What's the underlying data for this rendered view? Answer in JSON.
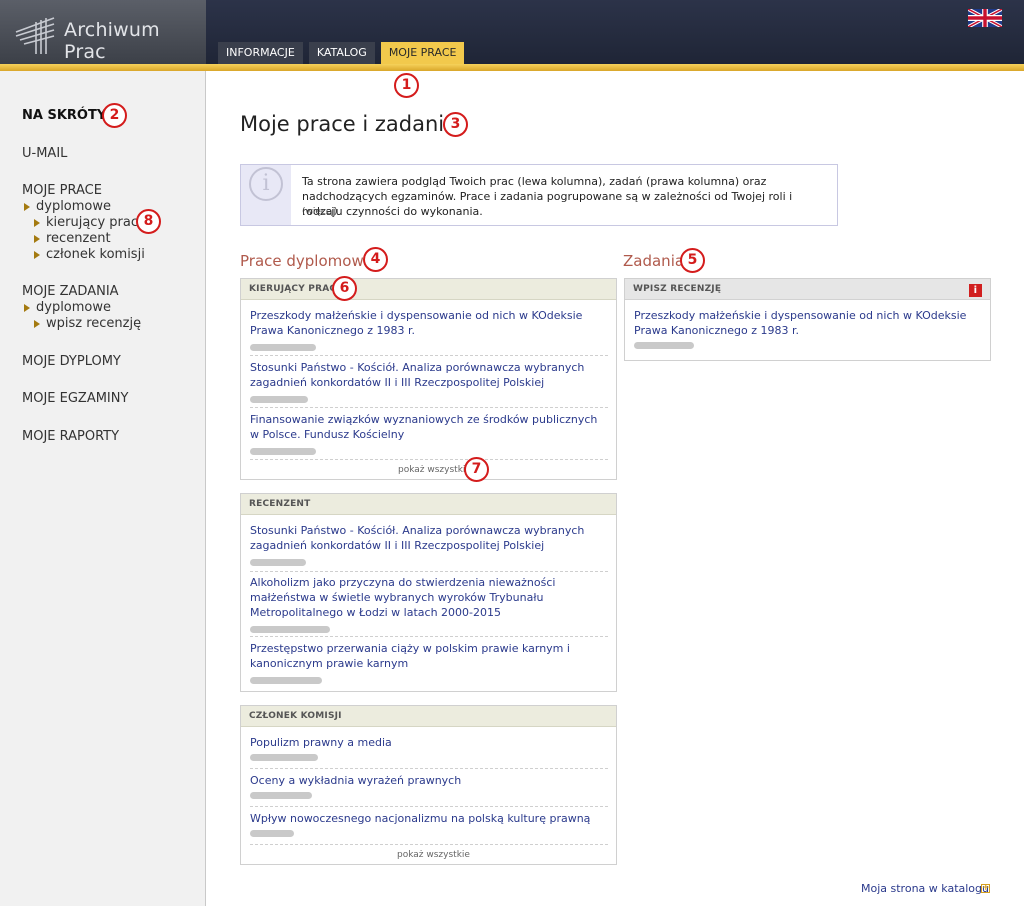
{
  "header": {
    "app_title": "Archiwum Prac",
    "tabs": [
      {
        "label": "INFORMACJE",
        "active": false
      },
      {
        "label": "KATALOG",
        "active": false
      },
      {
        "label": "MOJE PRACE",
        "active": true
      }
    ],
    "language_flag": "uk-flag-icon",
    "accent_color": "#f2c94c"
  },
  "sidebar": {
    "shortcuts": "NA SKRÓTY",
    "umail": "U-MAIL",
    "moje_prace": "MOJE PRACE",
    "moje_prace_dyplomowe": "dyplomowe",
    "moje_prace_items": [
      "kierujący pracą",
      "recenzent",
      "członek komisji"
    ],
    "moje_zadania": "MOJE ZADANIA",
    "moje_zadania_dyplomowe": "dyplomowe",
    "moje_zadania_items": [
      "wpisz recenzję"
    ],
    "moje_dyplomy": "MOJE DYPLOMY",
    "moje_egzaminy": "MOJE EGZAMINY",
    "moje_raporty": "MOJE RAPORTY"
  },
  "main": {
    "title": "Moje prace i zadania",
    "info": {
      "text": "Ta strona zawiera podgląd Twoich prac (lewa kolumna), zadań (prawa kolumna) oraz nadchodzących egzaminów. Prace i zadania pogrupowane są w zależności od Twojej roli i rodzaju czynności do wykonania.",
      "more": "(więcej)"
    },
    "prace_heading": "Prace dyplomowe",
    "zadania_heading": "Zadania",
    "kierujacy": {
      "header": "KIERUJĄCY PRACĄ",
      "items": [
        "Przeszkody małżeńskie i dyspensowanie od nich w KOdeksie Prawa Kanonicznego z 1983 r.",
        "Stosunki Państwo - Kościół. Analiza porównawcza wybranych zagadnień konkordatów II i III Rzeczpospolitej Polskiej",
        "Finansowanie związków wyznaniowych ze środków publicznych w Polsce. Fundusz Kościelny"
      ],
      "show_all": "pokaż wszystkie"
    },
    "recenzent": {
      "header": "RECENZENT",
      "items": [
        "Stosunki Państwo - Kościół. Analiza porównawcza wybranych zagadnień konkordatów II i III Rzeczpospolitej Polskiej",
        "Alkoholizm jako przyczyna do stwierdzenia nieważności małżeństwa w świetle wybranych wyroków Trybunału Metropolitalnego w Łodzi w latach 2000-2015",
        "Przestępstwo przerwania ciąży w polskim prawie karnym i kanonicznym prawie karnym"
      ]
    },
    "czlonek": {
      "header": "CZŁONEK KOMISJI",
      "items": [
        "Populizm prawny a media",
        "Oceny a wykładnia wyrażeń prawnych",
        "Wpływ nowoczesnego nacjonalizmu na polską kulturę prawną"
      ],
      "show_all": "pokaż wszystkie"
    },
    "wpisz": {
      "header": "WPISZ RECENZJĘ",
      "items": [
        "Przeszkody małżeńskie i dyspensowanie od nich w KOdeksie Prawa Kanonicznego z 1983 r."
      ]
    },
    "footer_link": "Moja strona w katalogu"
  },
  "markers": [
    "1",
    "2",
    "3",
    "4",
    "5",
    "6",
    "7",
    "8"
  ]
}
